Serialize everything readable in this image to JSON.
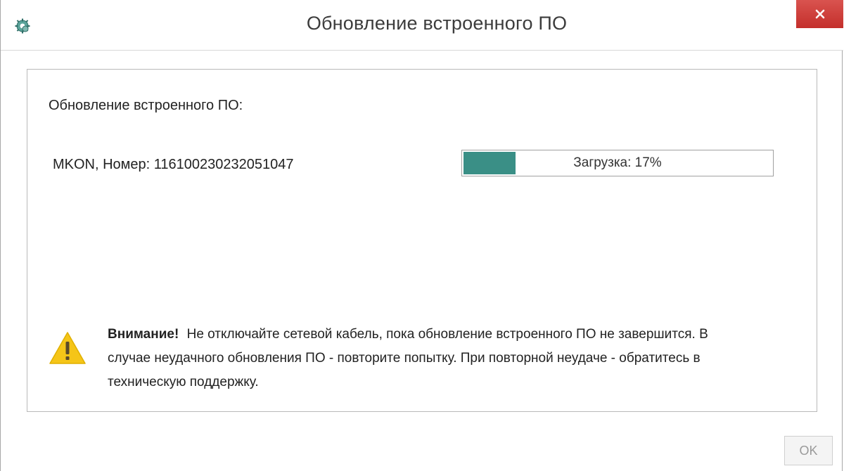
{
  "window": {
    "title": "Обновление встроенного ПО",
    "icon": "settings-gear-icon",
    "close_icon": "close-icon"
  },
  "content": {
    "heading": "Обновление встроенного ПО:",
    "device_label": "MKON, Номер: 116100230232051047",
    "progress": {
      "text": "Загрузка: 17%",
      "value": 0.17,
      "fill_color": "#3a8f86"
    },
    "warning": {
      "icon": "warning-icon",
      "title": "Внимание!",
      "message": "Не отключайте сетевой кабель, пока обновление встроенного ПО не завершится. В случае неудачного обновления ПО - повторите попытку. При повторной неудаче - обратитесь в техническую поддержку."
    }
  },
  "footer": {
    "ok_label": "OK",
    "ok_enabled": false
  },
  "colors": {
    "close_button": "#c9302c",
    "progress_fill": "#3a8f86",
    "warning_yellow": "#f5c518"
  }
}
